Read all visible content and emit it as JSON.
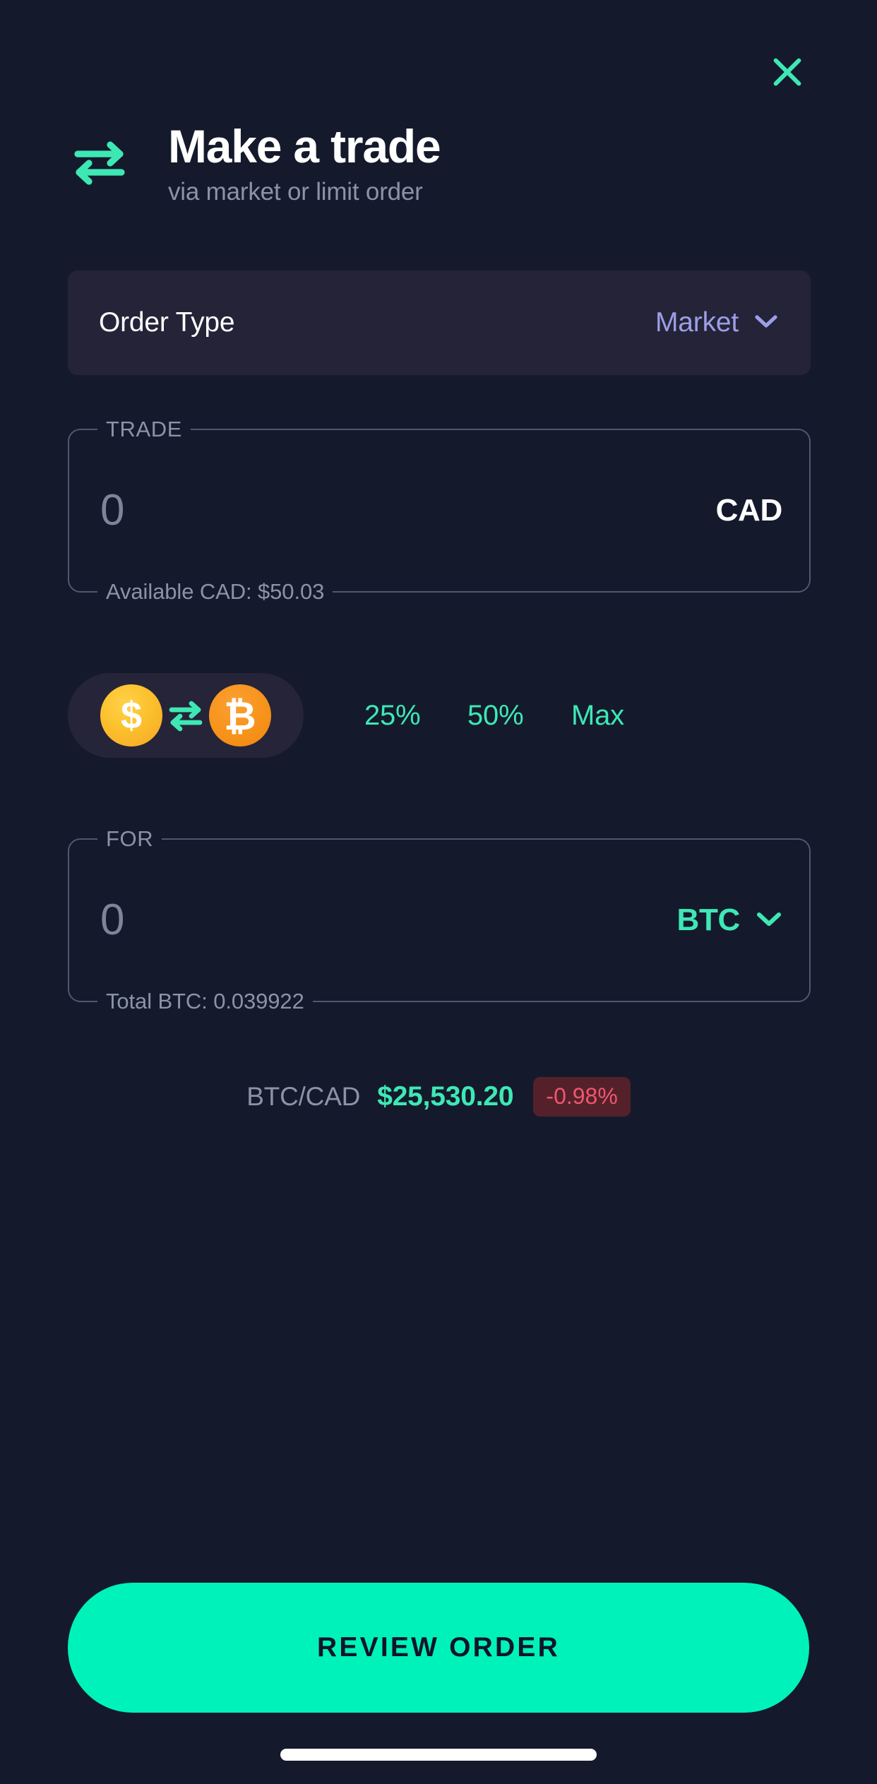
{
  "theme": {
    "background": "#141a2c",
    "card": "#252338",
    "accent_mint": "#3ee8b5",
    "accent_cta": "#00f2bb",
    "muted_text": "#8b93a7",
    "value_lavender": "#9d9ee6",
    "negative": "#f0566f",
    "negative_bg": "#54212a",
    "coin_cad": "#f5a623",
    "coin_btc": "#f7931a"
  },
  "header": {
    "title": "Make a trade",
    "subtitle": "via market or limit order",
    "swap_icon": "swap-arrows-icon",
    "close_icon": "close-icon"
  },
  "order_type": {
    "label": "Order Type",
    "value": "Market",
    "chevron_icon": "chevron-down-icon"
  },
  "trade_field": {
    "legend": "TRADE",
    "amount": "0",
    "currency": "CAD",
    "footnote": "Available CAD: $50.03"
  },
  "quick_amounts": {
    "pair_pill": {
      "from_symbol": "$",
      "swap_icon": "swap-arrows-icon",
      "to_symbol": "₿"
    },
    "buttons": [
      {
        "label": "25%"
      },
      {
        "label": "50%"
      },
      {
        "label": "Max"
      }
    ]
  },
  "for_field": {
    "legend": "FOR",
    "amount": "0",
    "currency": "BTC",
    "chevron_icon": "chevron-down-icon",
    "footnote": "Total BTC: 0.039922"
  },
  "price": {
    "pair": "BTC/CAD",
    "value": "$25,530.20",
    "change": "-0.98%"
  },
  "cta": {
    "label": "REVIEW ORDER"
  }
}
